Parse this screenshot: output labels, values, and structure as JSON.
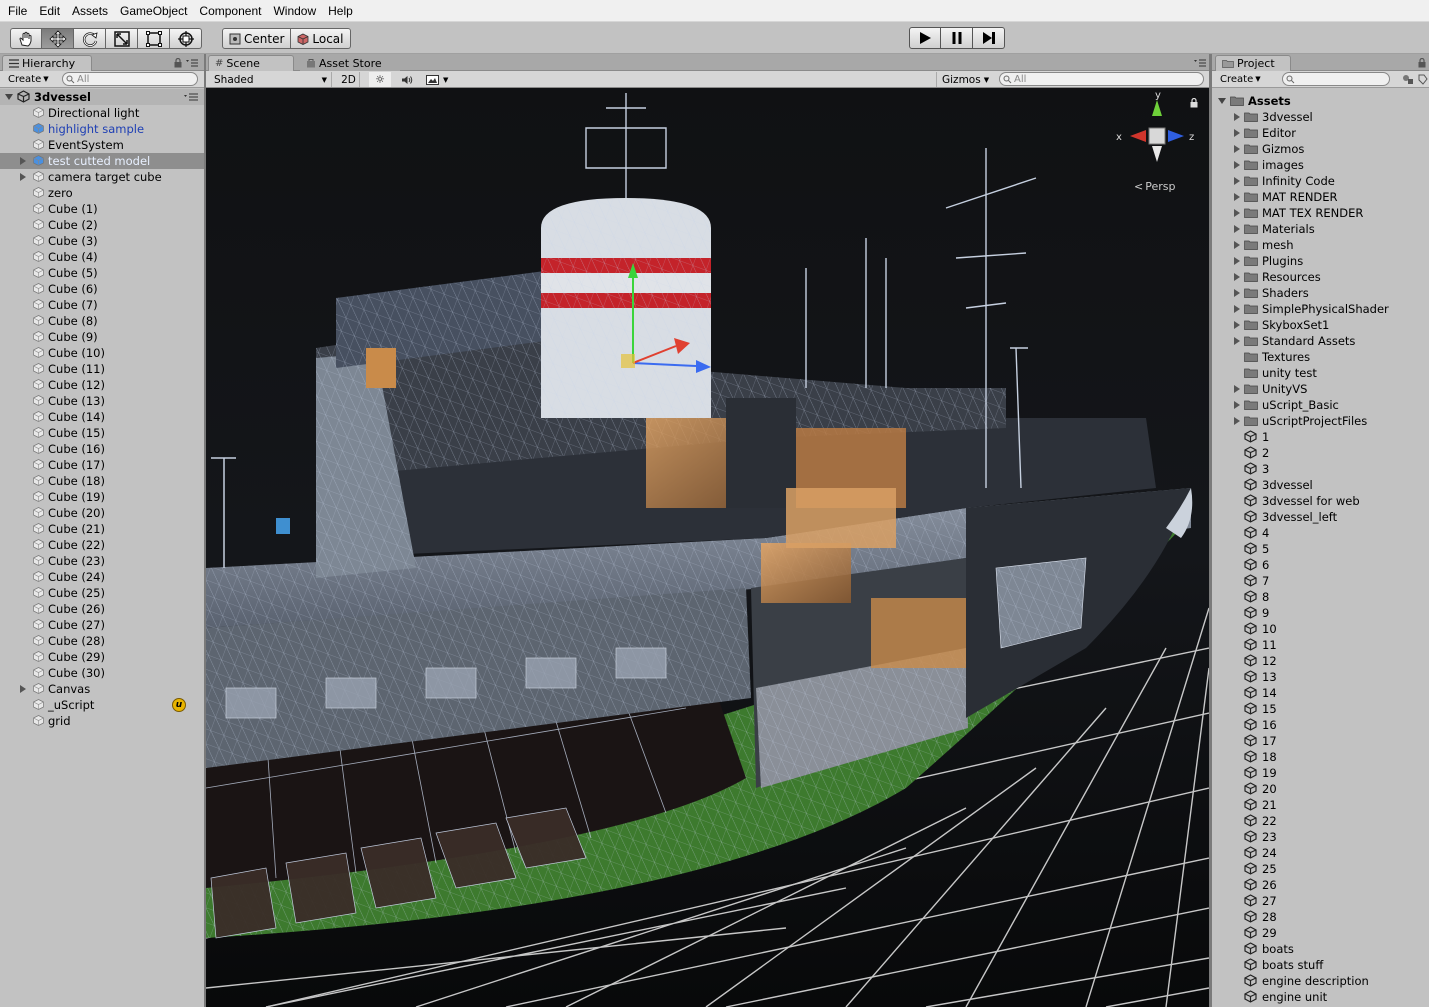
{
  "menu": [
    "File",
    "Edit",
    "Assets",
    "GameObject",
    "Component",
    "Window",
    "Help"
  ],
  "toolbar": {
    "tools": [
      "hand-icon",
      "move-icon",
      "rotate-icon",
      "scale-icon",
      "rect-icon",
      "transform-icon"
    ],
    "pivot_center": "Center",
    "pivot_local": "Local"
  },
  "hierarchy": {
    "tab": "Hierarchy",
    "create": "Create",
    "search_placeholder": "All",
    "scene_name": "3dvessel",
    "items": [
      {
        "label": "Directional light",
        "style": "normal",
        "expandable": false
      },
      {
        "label": "highlight sample",
        "style": "blue",
        "expandable": false
      },
      {
        "label": "EventSystem",
        "style": "normal",
        "expandable": false
      },
      {
        "label": "test cutted model",
        "style": "selected",
        "expandable": true
      },
      {
        "label": "camera target cube",
        "style": "normal",
        "expandable": true
      },
      {
        "label": "zero",
        "style": "normal",
        "expandable": false
      },
      {
        "label": "Cube (1)",
        "style": "normal",
        "expandable": false
      },
      {
        "label": "Cube (2)",
        "style": "normal",
        "expandable": false
      },
      {
        "label": "Cube (3)",
        "style": "normal",
        "expandable": false
      },
      {
        "label": "Cube (4)",
        "style": "normal",
        "expandable": false
      },
      {
        "label": "Cube (5)",
        "style": "normal",
        "expandable": false
      },
      {
        "label": "Cube (6)",
        "style": "normal",
        "expandable": false
      },
      {
        "label": "Cube (7)",
        "style": "normal",
        "expandable": false
      },
      {
        "label": "Cube (8)",
        "style": "normal",
        "expandable": false
      },
      {
        "label": "Cube (9)",
        "style": "normal",
        "expandable": false
      },
      {
        "label": "Cube (10)",
        "style": "normal",
        "expandable": false
      },
      {
        "label": "Cube (11)",
        "style": "normal",
        "expandable": false
      },
      {
        "label": "Cube (12)",
        "style": "normal",
        "expandable": false
      },
      {
        "label": "Cube (13)",
        "style": "normal",
        "expandable": false
      },
      {
        "label": "Cube (14)",
        "style": "normal",
        "expandable": false
      },
      {
        "label": "Cube (15)",
        "style": "normal",
        "expandable": false
      },
      {
        "label": "Cube (16)",
        "style": "normal",
        "expandable": false
      },
      {
        "label": "Cube (17)",
        "style": "normal",
        "expandable": false
      },
      {
        "label": "Cube (18)",
        "style": "normal",
        "expandable": false
      },
      {
        "label": "Cube (19)",
        "style": "normal",
        "expandable": false
      },
      {
        "label": "Cube (20)",
        "style": "normal",
        "expandable": false
      },
      {
        "label": "Cube (21)",
        "style": "normal",
        "expandable": false
      },
      {
        "label": "Cube (22)",
        "style": "normal",
        "expandable": false
      },
      {
        "label": "Cube (23)",
        "style": "normal",
        "expandable": false
      },
      {
        "label": "Cube (24)",
        "style": "normal",
        "expandable": false
      },
      {
        "label": "Cube (25)",
        "style": "normal",
        "expandable": false
      },
      {
        "label": "Cube (26)",
        "style": "normal",
        "expandable": false
      },
      {
        "label": "Cube (27)",
        "style": "normal",
        "expandable": false
      },
      {
        "label": "Cube (28)",
        "style": "normal",
        "expandable": false
      },
      {
        "label": "Cube (29)",
        "style": "normal",
        "expandable": false
      },
      {
        "label": "Cube (30)",
        "style": "normal",
        "expandable": false
      },
      {
        "label": "Canvas",
        "style": "normal",
        "expandable": true
      },
      {
        "label": "_uScript",
        "style": "normal",
        "expandable": false,
        "badge": "u"
      },
      {
        "label": "grid",
        "style": "normal",
        "expandable": false
      }
    ]
  },
  "scene": {
    "tab_scene": "Scene",
    "tab_store": "Asset Store",
    "shading": "Shaded",
    "mode_2d": "2D",
    "gizmos": "Gizmos",
    "search_placeholder": "All",
    "persp": "Persp",
    "axis_x": "x",
    "axis_y": "y",
    "axis_z": "z",
    "colors": {
      "hull_green": "#3d7a2e",
      "stripe_red": "#c4232a",
      "wire": "#b8c8e0",
      "interior": "#c98b4a",
      "grid": "#e8e8e8",
      "background": "#121316"
    }
  },
  "project": {
    "tab": "Project",
    "create": "Create",
    "root": "Assets",
    "folders": [
      {
        "label": "3dvessel",
        "expandable": true
      },
      {
        "label": "Editor",
        "expandable": true
      },
      {
        "label": "Gizmos",
        "expandable": true
      },
      {
        "label": "images",
        "expandable": true
      },
      {
        "label": "Infinity Code",
        "expandable": true
      },
      {
        "label": "MAT RENDER",
        "expandable": true
      },
      {
        "label": "MAT TEX RENDER",
        "expandable": true
      },
      {
        "label": "Materials",
        "expandable": true
      },
      {
        "label": "mesh",
        "expandable": true
      },
      {
        "label": "Plugins",
        "expandable": true
      },
      {
        "label": "Resources",
        "expandable": true
      },
      {
        "label": "Shaders",
        "expandable": true
      },
      {
        "label": "SimplePhysicalShader",
        "expandable": true
      },
      {
        "label": "SkyboxSet1",
        "expandable": true
      },
      {
        "label": "Standard Assets",
        "expandable": true
      },
      {
        "label": "Textures",
        "expandable": false
      },
      {
        "label": "unity test",
        "expandable": false
      },
      {
        "label": "UnityVS",
        "expandable": true
      },
      {
        "label": "uScript_Basic",
        "expandable": true
      },
      {
        "label": "uScriptProjectFiles",
        "expandable": true
      }
    ],
    "scenes": [
      "1",
      "2",
      "3",
      "3dvessel",
      "3dvessel for web",
      "3dvessel_left",
      "4",
      "5",
      "6",
      "7",
      "8",
      "9",
      "10",
      "11",
      "12",
      "13",
      "14",
      "15",
      "16",
      "17",
      "18",
      "19",
      "20",
      "21",
      "22",
      "23",
      "24",
      "25",
      "26",
      "27",
      "28",
      "29",
      "boats",
      "boats stuff",
      "engine description",
      "engine unit"
    ]
  }
}
